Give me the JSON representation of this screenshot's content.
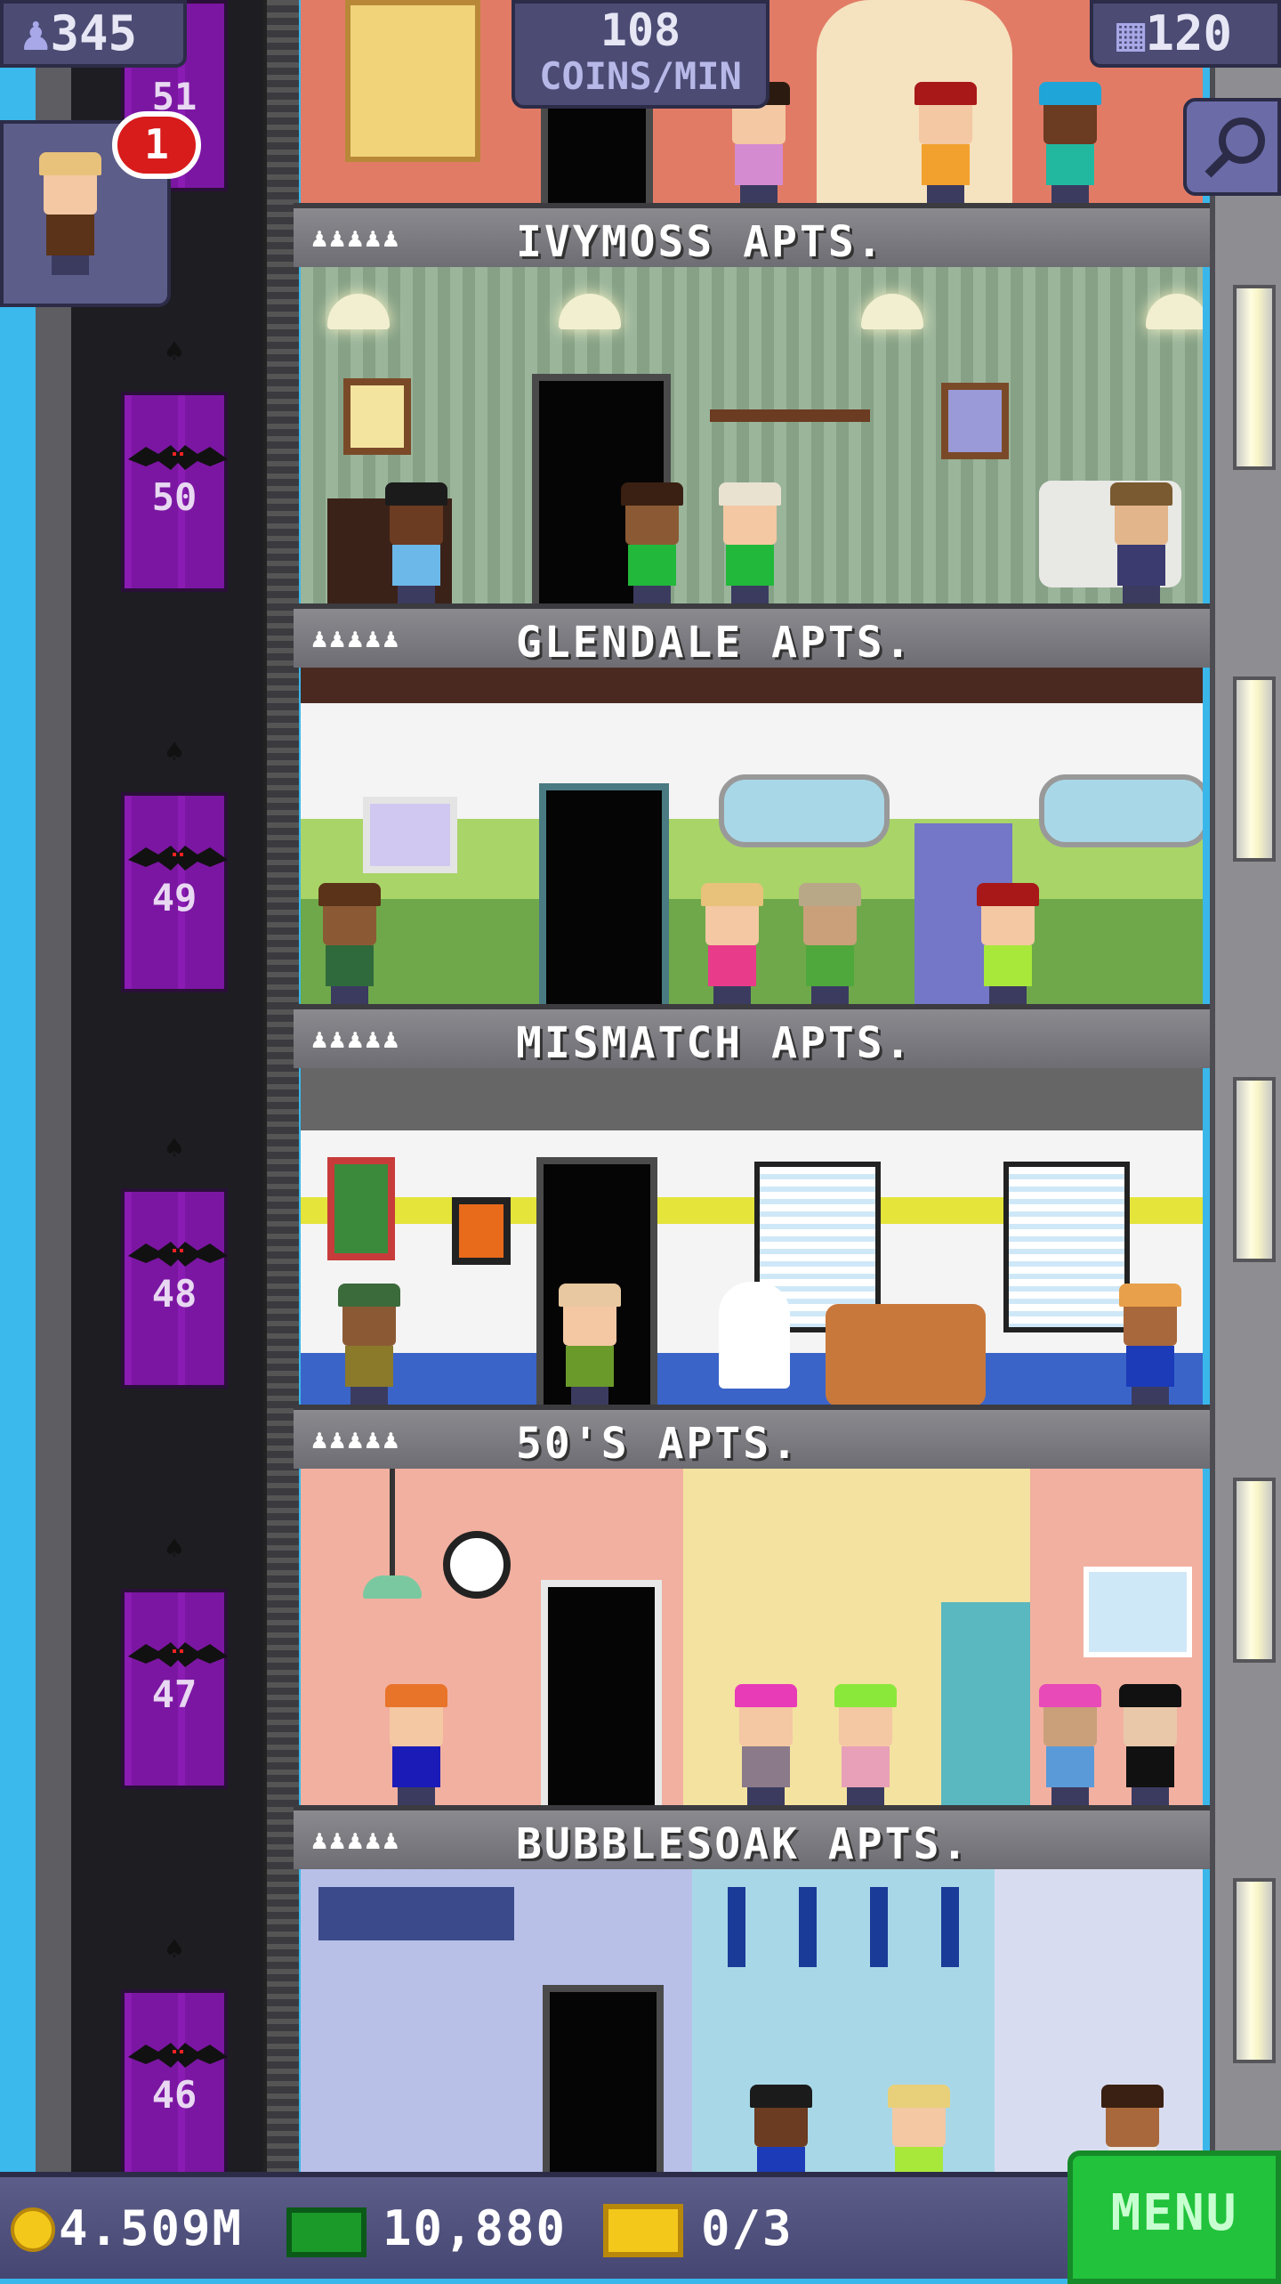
{
  "hud": {
    "population": "345",
    "coins_per_min_value": "108",
    "coins_per_min_label": "COINS/MIN",
    "floors_count": "120",
    "notification_count": "1"
  },
  "floors": [
    {
      "number": "51",
      "name": "IVYMOSS APTS."
    },
    {
      "number": "50",
      "name": "GLENDALE APTS."
    },
    {
      "number": "49",
      "name": "MISMATCH APTS."
    },
    {
      "number": "48",
      "name": "50'S APTS."
    },
    {
      "number": "47",
      "name": "BUBBLESOAK APTS."
    },
    {
      "number": "46",
      "name": ""
    }
  ],
  "bottom_bar": {
    "coins": "4.509M",
    "bux": "10,880",
    "tickets": "0/3",
    "menu_label": "MENU"
  },
  "icons": {
    "population": "person-icon",
    "floors": "building-icon",
    "search": "magnifier-icon",
    "coins": "coin-icon",
    "bux": "cash-icon",
    "tickets": "ticket-icon"
  },
  "colors": {
    "elevator": "#7b16a2",
    "hud_panel": "#4b4b74",
    "menu_button": "#22c23c",
    "sky": "#3bb8ec"
  }
}
